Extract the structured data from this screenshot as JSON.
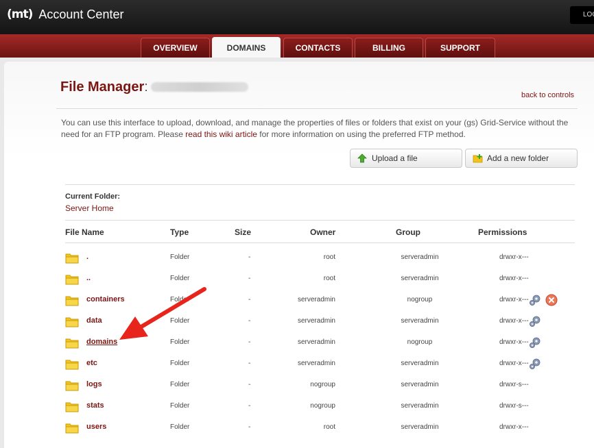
{
  "header": {
    "logo_text": "(mt)",
    "app_title": "Account Center",
    "logout_label": "LOGOUT"
  },
  "nav": {
    "tabs": [
      {
        "label": "OVERVIEW"
      },
      {
        "label": "DOMAINS",
        "active": true
      },
      {
        "label": "CONTACTS"
      },
      {
        "label": "BILLING"
      },
      {
        "label": "SUPPORT"
      }
    ]
  },
  "page": {
    "title": "File Manager",
    "title_colon": ":",
    "back_link": "back to controls",
    "intro_part1": "You can use this interface to upload, download, and manage the properties of files or folders that exist on your (gs) Grid-Service without the need for an FTP program. Please ",
    "intro_link": "read this wiki article",
    "intro_part2": " for more information on using the preferred FTP method."
  },
  "toolbar": {
    "upload_label": "Upload a file",
    "add_folder_label": "Add a new folder"
  },
  "current_folder": {
    "label": "Current Folder:",
    "value": "Server Home"
  },
  "table": {
    "headers": {
      "name": "File Name",
      "type": "Type",
      "size": "Size",
      "owner": "Owner",
      "group": "Group",
      "permissions": "Permissions"
    },
    "rows": [
      {
        "name": ".",
        "type": "Folder",
        "size": "-",
        "owner": "root",
        "group": "serveradmin",
        "permissions": "drwxr-x---",
        "gear": false,
        "delete": false
      },
      {
        "name": "..",
        "type": "Folder",
        "size": "-",
        "owner": "root",
        "group": "serveradmin",
        "permissions": "drwxr-x---",
        "gear": false,
        "delete": false
      },
      {
        "name": "containers",
        "type": "Folder",
        "size": "-",
        "owner": "serveradmin",
        "group": "nogroup",
        "permissions": "drwxr-x---",
        "gear": true,
        "delete": true
      },
      {
        "name": "data",
        "type": "Folder",
        "size": "-",
        "owner": "serveradmin",
        "group": "serveradmin",
        "permissions": "drwxr-x---",
        "gear": true,
        "delete": false
      },
      {
        "name": "domains",
        "type": "Folder",
        "size": "-",
        "owner": "serveradmin",
        "group": "nogroup",
        "permissions": "drwxr-x---",
        "gear": true,
        "delete": false,
        "underline": true
      },
      {
        "name": "etc",
        "type": "Folder",
        "size": "-",
        "owner": "serveradmin",
        "group": "serveradmin",
        "permissions": "drwxr-x---",
        "gear": true,
        "delete": false
      },
      {
        "name": "logs",
        "type": "Folder",
        "size": "-",
        "owner": "nogroup",
        "group": "serveradmin",
        "permissions": "drwxr-s---",
        "gear": false,
        "delete": false
      },
      {
        "name": "stats",
        "type": "Folder",
        "size": "-",
        "owner": "nogroup",
        "group": "serveradmin",
        "permissions": "drwxr-s---",
        "gear": false,
        "delete": false
      },
      {
        "name": "users",
        "type": "Folder",
        "size": "-",
        "owner": "root",
        "group": "serveradmin",
        "permissions": "drwxr-x---",
        "gear": false,
        "delete": false
      }
    ]
  },
  "icons": {
    "folder": "folder-icon",
    "gear": "gear-icon",
    "delete": "delete-icon",
    "upload": "up-arrow-icon",
    "add_folder": "add-folder-icon"
  },
  "colors": {
    "brand_red": "#7b1512",
    "nav_red": "#8b1e1c",
    "annotation_red": "#e8251c"
  }
}
